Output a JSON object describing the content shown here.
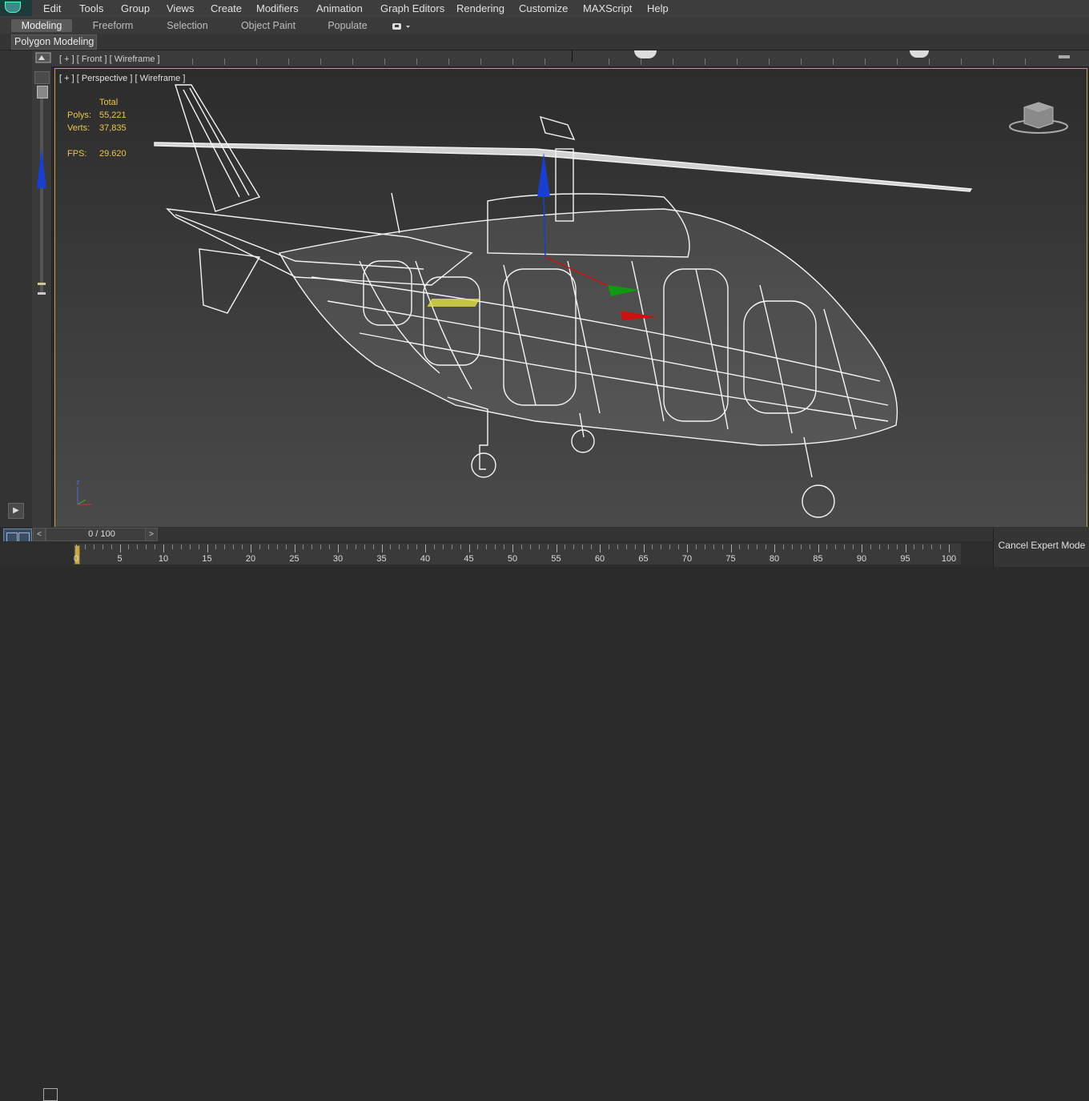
{
  "menubar": {
    "items": [
      "Edit",
      "Tools",
      "Group",
      "Views",
      "Create",
      "Modifiers",
      "Animation",
      "Graph Editors",
      "Rendering",
      "Customize",
      "MAXScript",
      "Help"
    ]
  },
  "ribbon": {
    "tabs": [
      "Modeling",
      "Freeform",
      "Selection",
      "Object Paint",
      "Populate"
    ],
    "active_tab": "Modeling",
    "panel_label": "Polygon Modeling"
  },
  "front_viewport": {
    "label": "[ + ] [ Front ] [ Wireframe ]"
  },
  "perspective_viewport": {
    "label": "[ + ] [ Perspective ] [ Wireframe ]",
    "stats": {
      "header": "Total",
      "polys_label": "Polys:",
      "polys_value": "55,221",
      "verts_label": "Verts:",
      "verts_value": "37,835",
      "fps_label": "FPS:",
      "fps_value": "29.620"
    },
    "tripod": {
      "z_label": "z"
    }
  },
  "timeline": {
    "frame_display": "0 / 100",
    "prev": "<",
    "next": ">",
    "tick_labels": [
      "0",
      "5",
      "10",
      "15",
      "20",
      "25",
      "30",
      "35",
      "40",
      "45",
      "50",
      "55",
      "60",
      "65",
      "70",
      "75",
      "80",
      "85",
      "90",
      "95",
      "100"
    ]
  },
  "status": {
    "cancel_expert_label": "Cancel Expert Mode"
  },
  "colors": {
    "accent": "#c7a14a",
    "stats_text": "#e8c84a",
    "wireframe": "#ffffff",
    "gizmo_x": "#cc1111",
    "gizmo_y": "#119911",
    "gizmo_z": "#1111cc"
  }
}
